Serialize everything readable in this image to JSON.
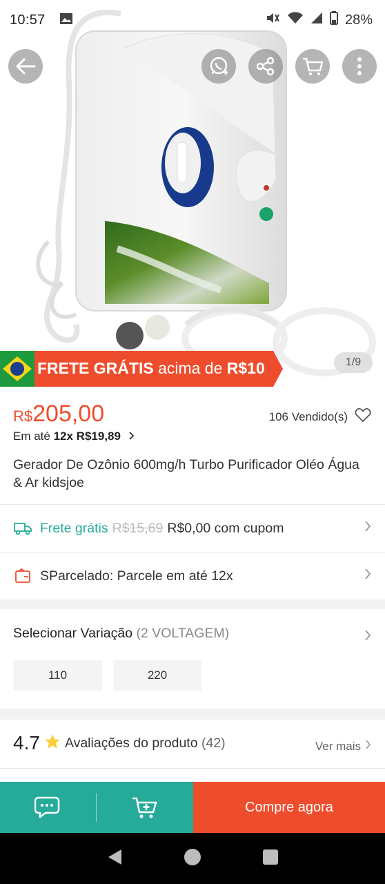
{
  "status_bar": {
    "time": "10:57",
    "battery": "28%",
    "icons": [
      "gallery-icon",
      "mute-icon",
      "wifi-icon",
      "signal-icon",
      "battery-icon"
    ]
  },
  "top_actions": [
    "back-arrow-icon",
    "whatsapp-share-icon",
    "share-icon",
    "cart-icon",
    "more-vertical-icon"
  ],
  "banner": {
    "part1": "FRETE GRÁTIS",
    "part2": "acima de",
    "part3": "R$10",
    "flag": "brazil-flag-icon",
    "color": "#ee4d2d"
  },
  "image_counter": "1/9",
  "product": {
    "currency": "R$",
    "price": "205,00",
    "installment_prefix": "Em até",
    "installment_value": "12x R$19,89",
    "sold": "106 Vendido(s)",
    "title": "Gerador De Ozônio 600mg/h Turbo Purificador Oléo Água & Ar kidsjoe"
  },
  "shipping": {
    "label": "Frete grátis",
    "old_price": "R$15,69",
    "new_price": "R$0,00 com cupom"
  },
  "parcel": {
    "label": "SParcelado: Parcele em até 12x"
  },
  "variation": {
    "title": "Selecionar Variação",
    "count": "(2 VOLTAGEM)",
    "options": [
      "110",
      "220"
    ]
  },
  "rating": {
    "score": "4.7",
    "label": "Avaliações do produto",
    "count": "(42)",
    "see_more": "Ver mais"
  },
  "actions": {
    "buy_now": "Compre agora"
  },
  "colors": {
    "accent": "#ee4d2d",
    "teal": "#26aa99"
  }
}
